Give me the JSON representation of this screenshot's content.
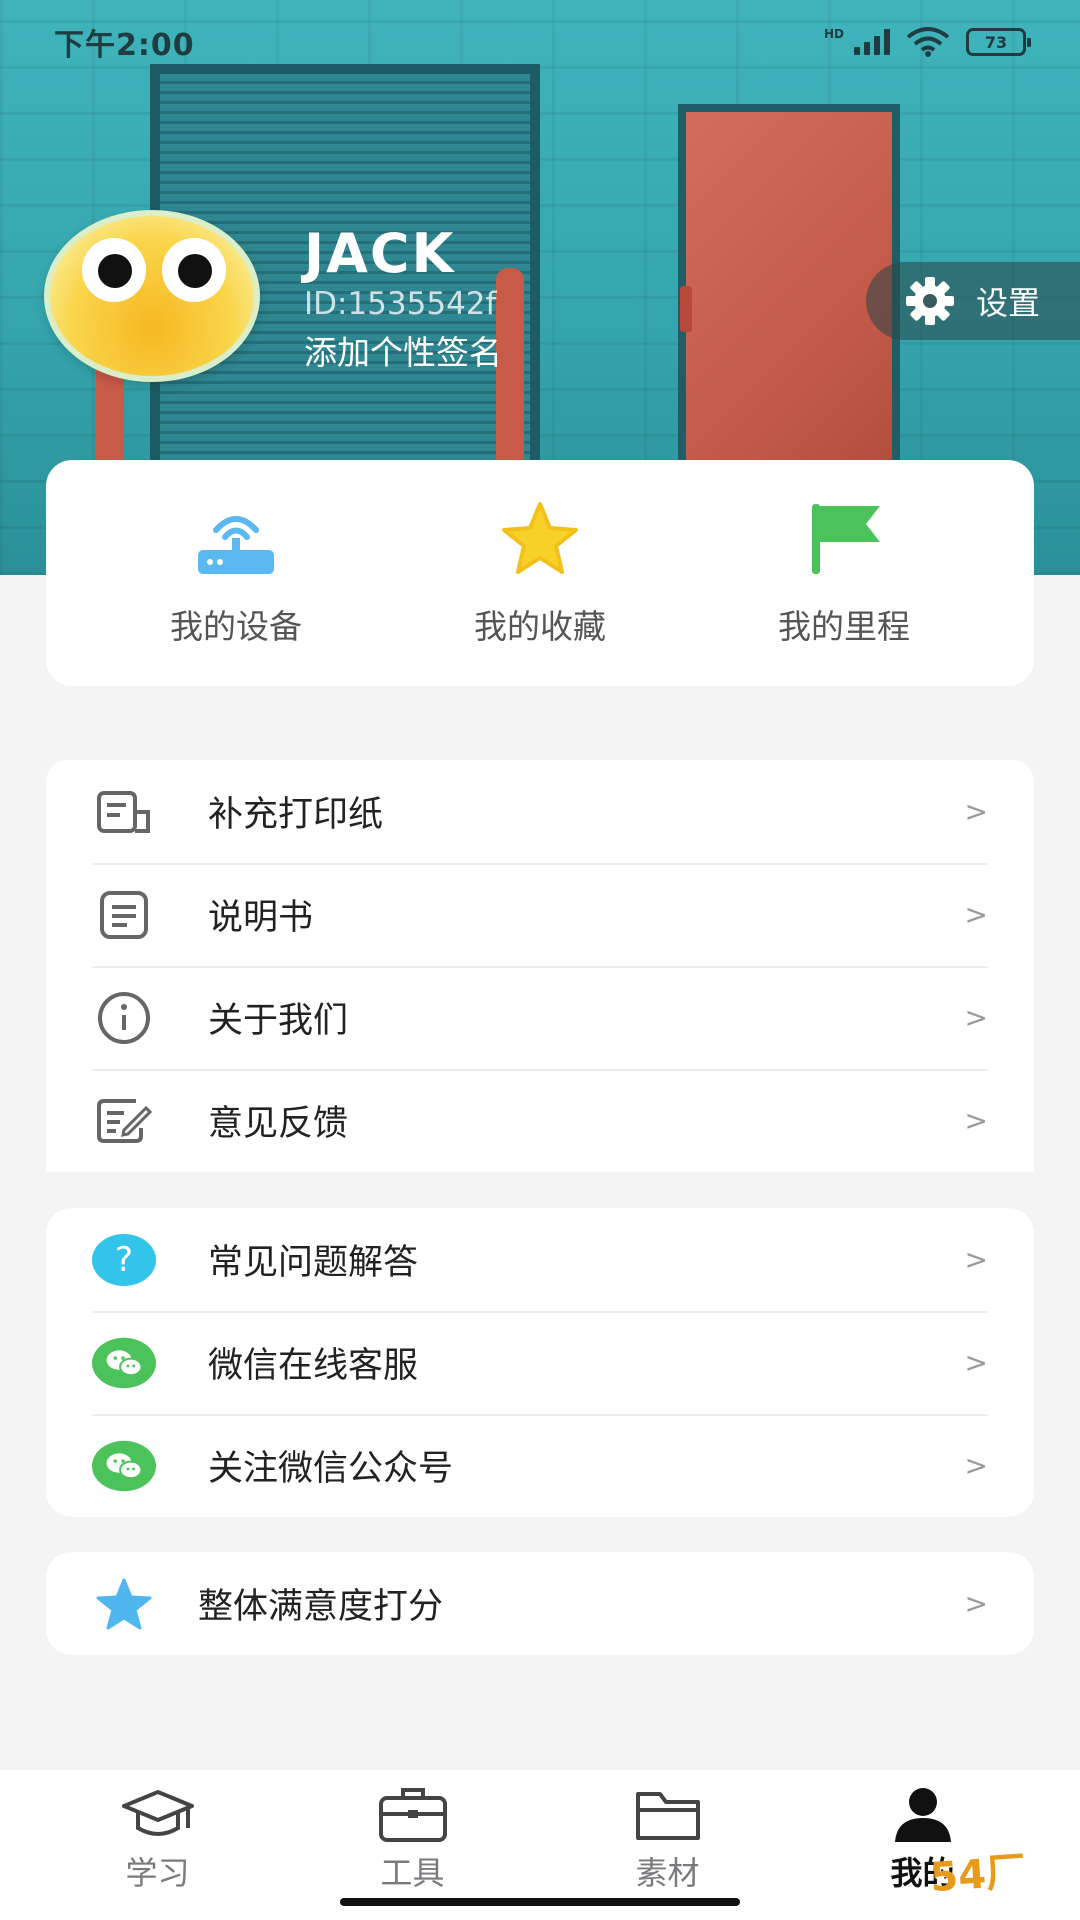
{
  "status_bar": {
    "time": "下午2:00",
    "network": "HD",
    "battery": "73"
  },
  "profile": {
    "name": "JACK",
    "id": "ID:1535542f",
    "signature": "添加个性签名"
  },
  "settings": {
    "label": "设置"
  },
  "quick_actions": [
    {
      "label": "我的设备",
      "icon": "router-icon",
      "color": "#5bb8f0"
    },
    {
      "label": "我的收藏",
      "icon": "star-icon",
      "color": "#f7d12a"
    },
    {
      "label": "我的里程",
      "icon": "flag-icon",
      "color": "#4cc35a"
    }
  ],
  "menu_group_1": [
    {
      "label": "补充打印纸",
      "icon": "print-paper-icon"
    },
    {
      "label": "说明书",
      "icon": "manual-icon"
    },
    {
      "label": "关于我们",
      "icon": "info-icon"
    },
    {
      "label": "意见反馈",
      "icon": "feedback-icon"
    }
  ],
  "menu_group_2": [
    {
      "label": "常见问题解答",
      "icon": "question-icon",
      "color": "#33c4ea"
    },
    {
      "label": "微信在线客服",
      "icon": "wechat-icon",
      "color": "#4cc35a"
    },
    {
      "label": "关注微信公众号",
      "icon": "wechat-icon",
      "color": "#4cc35a"
    }
  ],
  "menu_group_3": [
    {
      "label": "整体满意度打分",
      "icon": "star-icon",
      "color": "#4fb6ee"
    }
  ],
  "chevron": ">",
  "tabbar": [
    {
      "label": "学习",
      "icon": "graduation-cap-icon",
      "active": false
    },
    {
      "label": "工具",
      "icon": "toolbox-icon",
      "active": false
    },
    {
      "label": "素材",
      "icon": "folder-icon",
      "active": false
    },
    {
      "label": "我的",
      "icon": "person-icon",
      "active": true
    }
  ],
  "watermark": "54厂"
}
